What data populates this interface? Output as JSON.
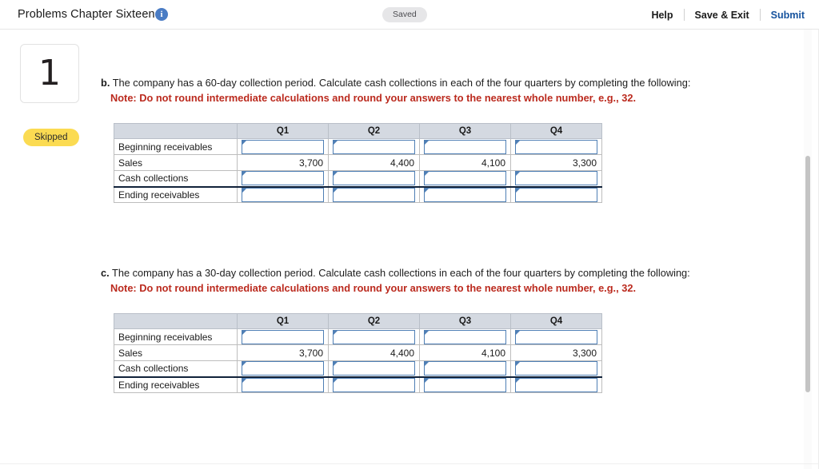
{
  "header": {
    "title": "Problems Chapter Sixteen",
    "info_icon": "info-icon",
    "status_badge": "Saved",
    "actions": {
      "help": "Help",
      "save_exit": "Save & Exit",
      "submit": "Submit"
    },
    "colors": {
      "submit_link": "#16539e",
      "badge_bg": "#e6e6e8"
    }
  },
  "question_rail": {
    "number": "1",
    "status": "Skipped",
    "status_color": "#fbdb52"
  },
  "parts": [
    {
      "letter": "b.",
      "prompt": "The company has a 60-day collection period. Calculate cash collections in each of the four quarters by completing the following:",
      "note": "Note: Do not round intermediate calculations and round your answers to the nearest whole number, e.g., 32.",
      "note_color": "#bb2a1e",
      "table": {
        "corner": "",
        "columns": [
          "Q1",
          "Q2",
          "Q3",
          "Q4"
        ],
        "rows": [
          {
            "label": "Beginning receivables",
            "type": "input",
            "values": [
              "",
              "",
              "",
              ""
            ]
          },
          {
            "label": "Sales",
            "type": "value",
            "values": [
              "3,700",
              "4,400",
              "4,100",
              "3,300"
            ]
          },
          {
            "label": "Cash collections",
            "type": "input",
            "values": [
              "",
              "",
              "",
              ""
            ]
          },
          {
            "label": "Ending receivables",
            "type": "input",
            "values": [
              "",
              "",
              "",
              ""
            ]
          }
        ]
      }
    },
    {
      "letter": "c.",
      "prompt": "The company has a 30-day collection period. Calculate cash collections in each of the four quarters by completing the following:",
      "note": "Note: Do not round intermediate calculations and round your answers to the nearest whole number, e.g., 32.",
      "note_color": "#bb2a1e",
      "table": {
        "corner": "",
        "columns": [
          "Q1",
          "Q2",
          "Q3",
          "Q4"
        ],
        "rows": [
          {
            "label": "Beginning receivables",
            "type": "input",
            "values": [
              "",
              "",
              "",
              ""
            ]
          },
          {
            "label": "Sales",
            "type": "value",
            "values": [
              "3,700",
              "4,400",
              "4,100",
              "3,300"
            ]
          },
          {
            "label": "Cash collections",
            "type": "input",
            "values": [
              "",
              "",
              "",
              ""
            ]
          },
          {
            "label": "Ending receivables",
            "type": "input",
            "values": [
              "",
              "",
              "",
              ""
            ]
          }
        ]
      }
    }
  ],
  "scrollbar": {
    "orientation": "vertical"
  }
}
